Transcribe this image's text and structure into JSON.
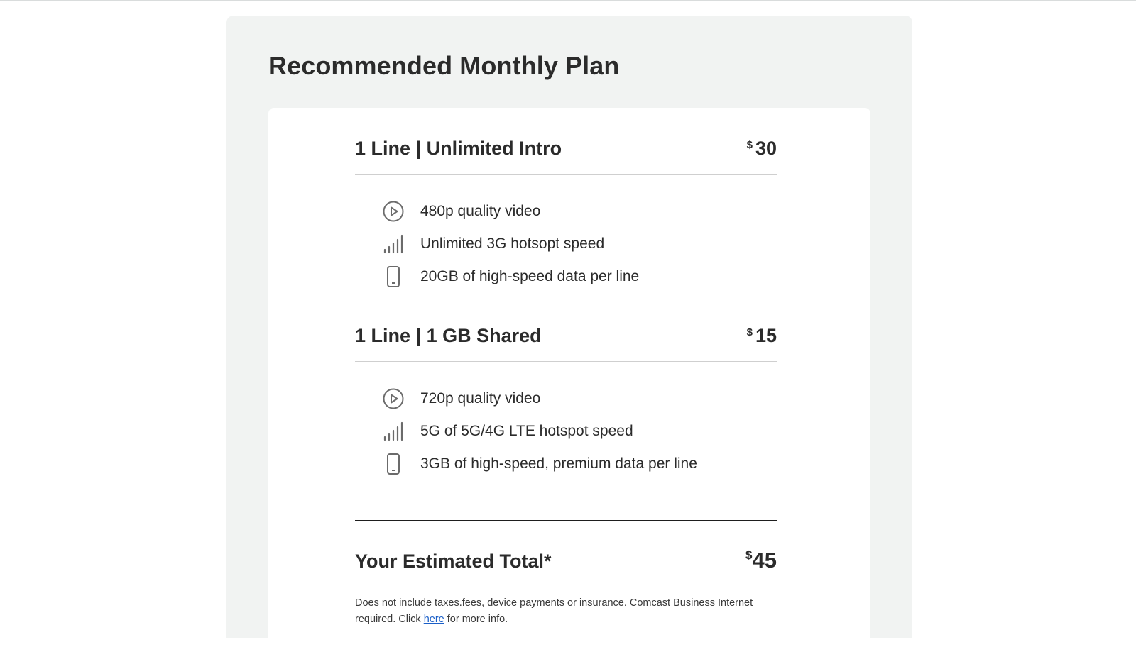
{
  "panel": {
    "title": "Recommended Monthly Plan"
  },
  "plans": [
    {
      "name": "1 Line | Unlimited Intro",
      "currency": "$",
      "price": "30",
      "features": [
        {
          "icon": "play-circle-icon",
          "text": "480p quality video"
        },
        {
          "icon": "signal-bars-icon",
          "text": "Unlimited 3G hotsopt speed"
        },
        {
          "icon": "smartphone-icon",
          "text": "20GB of high-speed data per line"
        }
      ]
    },
    {
      "name": "1 Line | 1 GB Shared",
      "currency": "$",
      "price": "15",
      "features": [
        {
          "icon": "play-circle-icon",
          "text": "720p quality video"
        },
        {
          "icon": "signal-bars-icon",
          "text": "5G of 5G/4G LTE hotspot speed"
        },
        {
          "icon": "smartphone-icon",
          "text": "3GB of high-speed, premium data per line"
        }
      ]
    }
  ],
  "total": {
    "label": "Your Estimated Total*",
    "currency": "$",
    "price": "45"
  },
  "disclaimer": {
    "text_before": "Does not include taxes.fees, device payments or insurance. Comcast Business Internet required. Click ",
    "link_label": "here",
    "text_after": " for more info."
  },
  "colors": {
    "panel_bg": "#f1f3f2",
    "card_bg": "#ffffff",
    "text": "#2b2b2b",
    "icon": "#6b6b6b",
    "link": "#1a5fc8"
  }
}
